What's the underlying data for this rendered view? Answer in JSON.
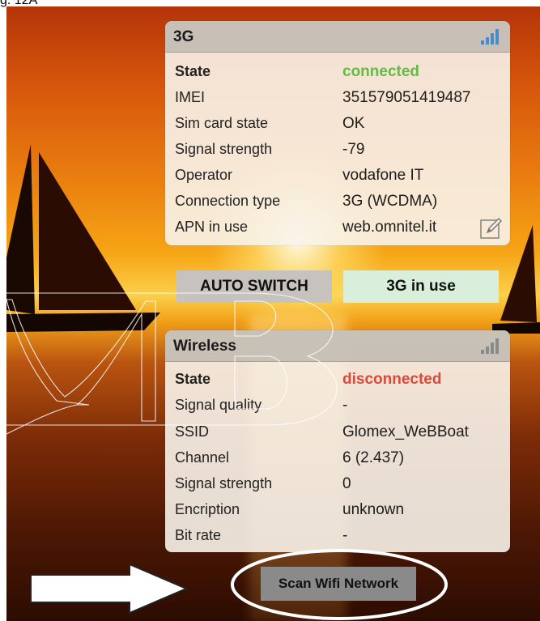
{
  "caption": "g. 12A",
  "panel_3g": {
    "title": "3G",
    "rows": [
      {
        "label": "State",
        "value": "connected"
      },
      {
        "label": "IMEI",
        "value": "351579051419487"
      },
      {
        "label": "Sim card state",
        "value": "OK"
      },
      {
        "label": "Signal strength",
        "value": "-79"
      },
      {
        "label": "Operator",
        "value": "vodafone IT"
      },
      {
        "label": "Connection type",
        "value": "3G (WCDMA)"
      },
      {
        "label": "APN in use",
        "value": "web.omnitel.it"
      }
    ],
    "edit_icon": "edit-icon"
  },
  "buttons": {
    "auto_switch": "AUTO SWITCH",
    "in_use": "3G in use",
    "scan": "Scan Wifi Network"
  },
  "panel_wireless": {
    "title": "Wireless",
    "rows": [
      {
        "label": "State",
        "value": "disconnected"
      },
      {
        "label": "Signal quality",
        "value": "-"
      },
      {
        "label": "SSID",
        "value": "Glomex_WeBBoat"
      },
      {
        "label": "Channel",
        "value": "6 (2.437)"
      },
      {
        "label": "Signal strength",
        "value": "0"
      },
      {
        "label": "Encription",
        "value": "unknown"
      },
      {
        "label": "Bit rate",
        "value": "-"
      }
    ]
  },
  "colors": {
    "connected": "#67b947",
    "disconnected": "#d84a3a",
    "signal_3g": "#4a8cc8",
    "signal_wireless": "#8a8a8a"
  }
}
